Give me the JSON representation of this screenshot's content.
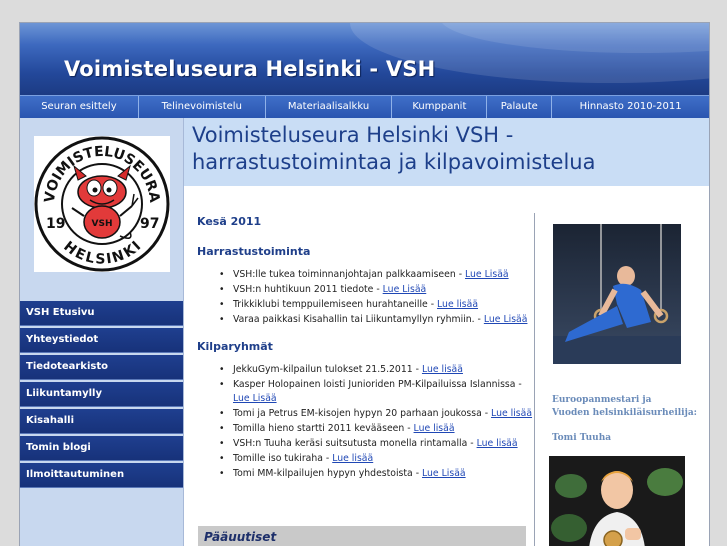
{
  "header": {
    "site_title": "Voimisteluseura Helsinki - VSH"
  },
  "nav": {
    "items": [
      {
        "label": "Seuran esittely"
      },
      {
        "label": "Telinevoimistelu"
      },
      {
        "label": "Materiaalisalkku"
      },
      {
        "label": "Kumppanit"
      },
      {
        "label": "Palaute"
      },
      {
        "label": "Hinnasto 2010-2011"
      }
    ]
  },
  "logo": {
    "top_text": "VOIMISTELUSEURA",
    "bottom_text": "HELSINKI",
    "year_left": "19",
    "year_right": "97",
    "badge": "VSH"
  },
  "sidebar": {
    "items": [
      {
        "label": "VSH Etusivu"
      },
      {
        "label": "Yhteystiedot"
      },
      {
        "label": "Tiedotearkisto"
      },
      {
        "label": "Liikuntamylly"
      },
      {
        "label": "Kisahalli"
      },
      {
        "label": "Tomin blogi"
      },
      {
        "label": "Ilmoittautuminen"
      }
    ]
  },
  "main": {
    "title_line1": "Voimisteluseura Helsinki  VSH -",
    "title_line2": "harrastustoimintaa ja kilpavoimistelua",
    "season": "Kesä 2011",
    "harrastus": {
      "heading": "Harrastustoiminta",
      "items": [
        {
          "text": "VSH:lle tukea toiminnanjohtajan palkkaamiseen - ",
          "link": "Lue Lisää"
        },
        {
          "text": "VSH:n huhtikuun 2011 tiedote - ",
          "link": "Lue Lisää"
        },
        {
          "text": "Trikkiklubi temppuilemiseen hurahtaneille - ",
          "link": "Lue lisää"
        },
        {
          "text": "Varaa paikkasi Kisahallin tai Liikuntamyllyn ryhmiin.  - ",
          "link": "Lue Lisää"
        }
      ]
    },
    "kilpa": {
      "heading": "Kilparyhmät",
      "items": [
        {
          "text": "JekkuGym-kilpailun tulokset 21.5.2011 - ",
          "link": "Lue lisää"
        },
        {
          "text": "Kasper Holopainen loisti Junioriden PM-Kilpailuissa Islannissa - ",
          "link": "Lue Lisää"
        },
        {
          "text": "Tomi ja Petrus EM-kisojen hypyn 20 parhaan joukossa - ",
          "link": "Lue lisää"
        },
        {
          "text": "Tomilla hieno startti 2011 kevääseen - ",
          "link": "Lue lisää"
        },
        {
          "text": "VSH:n Tuuha keräsi suitsutusta monella rintamalla - ",
          "link": "Lue lisää"
        },
        {
          "text": "Tomille iso tukiraha - ",
          "link": "Lue lisää"
        },
        {
          "text": "Tomi MM-kilpailujen hypyn yhdestoista - ",
          "link": "Lue Lisää"
        }
      ]
    },
    "pauutiset": "Pääuutiset"
  },
  "right": {
    "caption_line1": "Euroopanmestari ja",
    "caption_line2": "Vuoden helsinkiläisurheilija:",
    "caption_name": "Tomi Tuuha"
  },
  "colors": {
    "banner": "#2a55b0",
    "sidebar_item": "#1f3f8f",
    "title": "#1d3f8a",
    "link": "#1f47b5"
  }
}
